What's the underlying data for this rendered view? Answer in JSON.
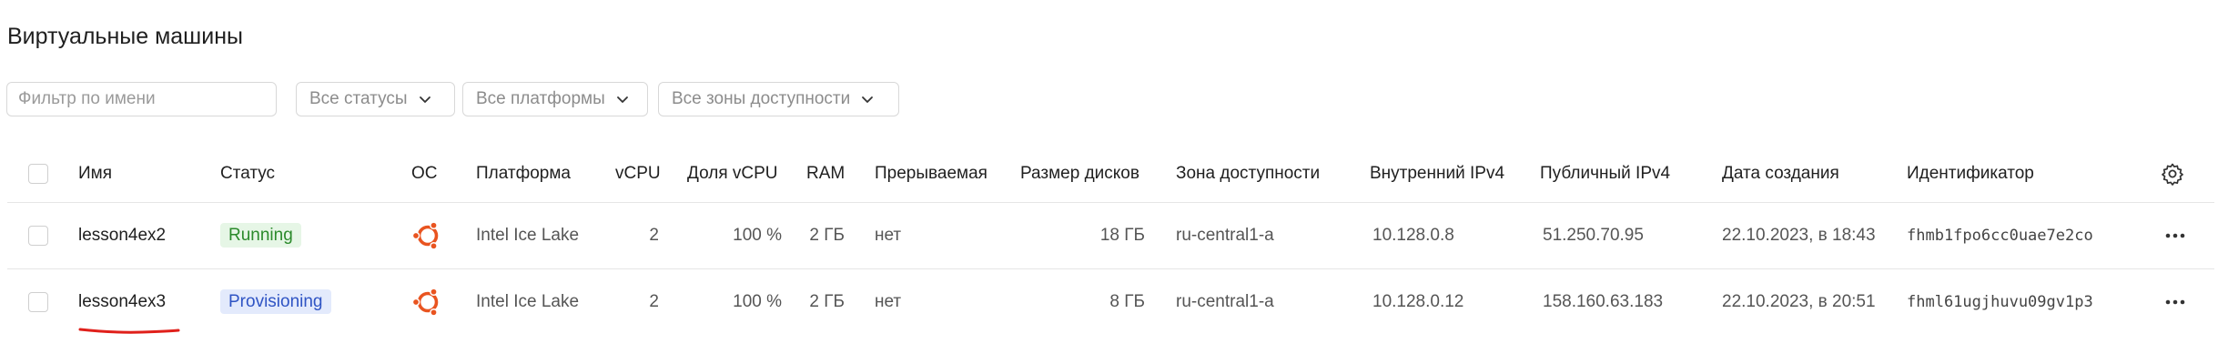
{
  "page": {
    "title": "Виртуальные машины"
  },
  "filters": {
    "name_placeholder": "Фильтр по имени",
    "status_select": "Все статусы",
    "platform_select": "Все платформы",
    "zone_select": "Все зоны доступности"
  },
  "table": {
    "headers": {
      "name": "Имя",
      "status": "Статус",
      "os": "ОС",
      "platform": "Платформа",
      "vcpu": "vCPU",
      "vcpu_share": "Доля vCPU",
      "ram": "RAM",
      "preemptible": "Прерываемая",
      "disk_size": "Размер дисков",
      "zone": "Зона доступности",
      "internal_ip": "Внутренний IPv4",
      "public_ip": "Публичный IPv4",
      "created": "Дата создания",
      "id": "Идентификатор"
    },
    "rows": [
      {
        "name": "lesson4ex2",
        "status": "Running",
        "os": "ubuntu-icon",
        "platform": "Intel Ice Lake",
        "vcpu": "2",
        "vcpu_share": "100 %",
        "ram": "2 ГБ",
        "preemptible": "нет",
        "disk_size": "18 ГБ",
        "zone": "ru-central1-a",
        "internal_ip": "10.128.0.8",
        "public_ip": "51.250.70.95",
        "created": "22.10.2023, в 18:43",
        "id": "fhmb1fpo6cc0uae7e2co"
      },
      {
        "name": "lesson4ex3",
        "status": "Provisioning",
        "os": "ubuntu-icon",
        "platform": "Intel Ice Lake",
        "vcpu": "2",
        "vcpu_share": "100 %",
        "ram": "2 ГБ",
        "preemptible": "нет",
        "disk_size": "8 ГБ",
        "zone": "ru-central1-a",
        "internal_ip": "10.128.0.12",
        "public_ip": "158.160.63.183",
        "created": "22.10.2023, в 20:51",
        "id": "fhml61ugjhuvu09gv1p3"
      }
    ]
  },
  "colors": {
    "running_bg": "#e6f6e6",
    "running_text": "#2b8a2b",
    "provisioning_bg": "#e3eafc",
    "provisioning_text": "#2f54c4",
    "ubuntu_orange": "#e95420",
    "annotation_red": "#e0201b"
  }
}
